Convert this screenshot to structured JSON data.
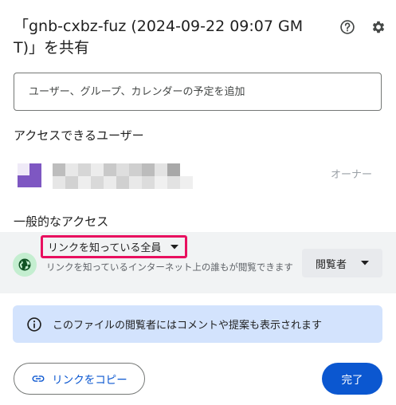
{
  "dialog": {
    "title": "「gnb-cxbz-fuz (2024-09-22 09:07 GMT)」を共有"
  },
  "people_input": {
    "placeholder": "ユーザー、グループ、カレンダーの予定を追加"
  },
  "people_with_access": {
    "heading": "アクセスできるユーザー",
    "users": [
      {
        "role": "オーナー",
        "avatar_color": "#7e57c2"
      }
    ]
  },
  "general_access": {
    "heading": "一般的なアクセス",
    "selected": "リンクを知っている全員",
    "description": "リンクを知っているインターネット上の誰もが閲覧できます",
    "role": "閲覧者",
    "highlight_color": "#e8105f",
    "globe_bg_color": "#c4eed0"
  },
  "info": {
    "text": "このファイルの閲覧者にはコメントや提案も表示されます"
  },
  "footer": {
    "copy_link_label": "リンクをコピー",
    "done_label": "完了"
  },
  "colors": {
    "primary": "#0b57d0",
    "info_bg": "#d3e3fd",
    "band_bg": "#f1f3f4"
  },
  "icons": {
    "help": "help-icon",
    "settings": "gear-icon",
    "globe": "globe-icon",
    "info": "info-icon",
    "link": "link-icon",
    "dropdown": "caret-down-icon"
  }
}
